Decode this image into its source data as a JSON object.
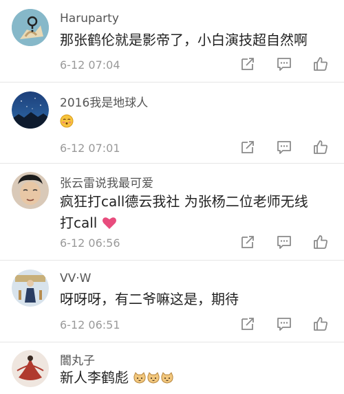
{
  "comments": [
    {
      "username": "Haruparty",
      "lines": [
        "那张鹤伦就是影帝了，小白演技超自然啊"
      ],
      "time": "6-12 07:04",
      "avatar": "avatar-question-dog",
      "actions": [
        "share-icon",
        "reply-icon",
        "like-icon"
      ]
    },
    {
      "username": "2016我是地球人",
      "lines": [
        ""
      ],
      "emoji": "blushing-face-emoji",
      "time": "6-12 07:01",
      "avatar": "avatar-night-sky",
      "actions": [
        "share-icon",
        "reply-icon",
        "like-icon"
      ]
    },
    {
      "username": "张云雷说我最可爱",
      "lines": [
        "疯狂打call德云我社  为张杨二位老师无线",
        "打call"
      ],
      "emoji": "heart-emoji",
      "time": "6-12 06:56",
      "avatar": "avatar-man-face",
      "actions": [
        "share-icon",
        "reply-icon",
        "like-icon"
      ]
    },
    {
      "username": "VV·W",
      "lines": [
        "呀呀呀，有二爷嘛这是，期待"
      ],
      "time": "6-12 06:51",
      "avatar": "avatar-stage-performer",
      "actions": [
        "share-icon",
        "reply-icon",
        "like-icon"
      ]
    },
    {
      "username": "闟丸子",
      "lines": [
        "新人李鹤彪"
      ],
      "emoji": "cat-emoji",
      "time": "",
      "avatar": "avatar-dancer",
      "actions": []
    }
  ],
  "colors": {
    "username": "#555555",
    "body": "#222222",
    "time": "#999999",
    "icon": "#8a8a8a",
    "divider": "#e6e6e6",
    "heart": "#e84c7d"
  }
}
